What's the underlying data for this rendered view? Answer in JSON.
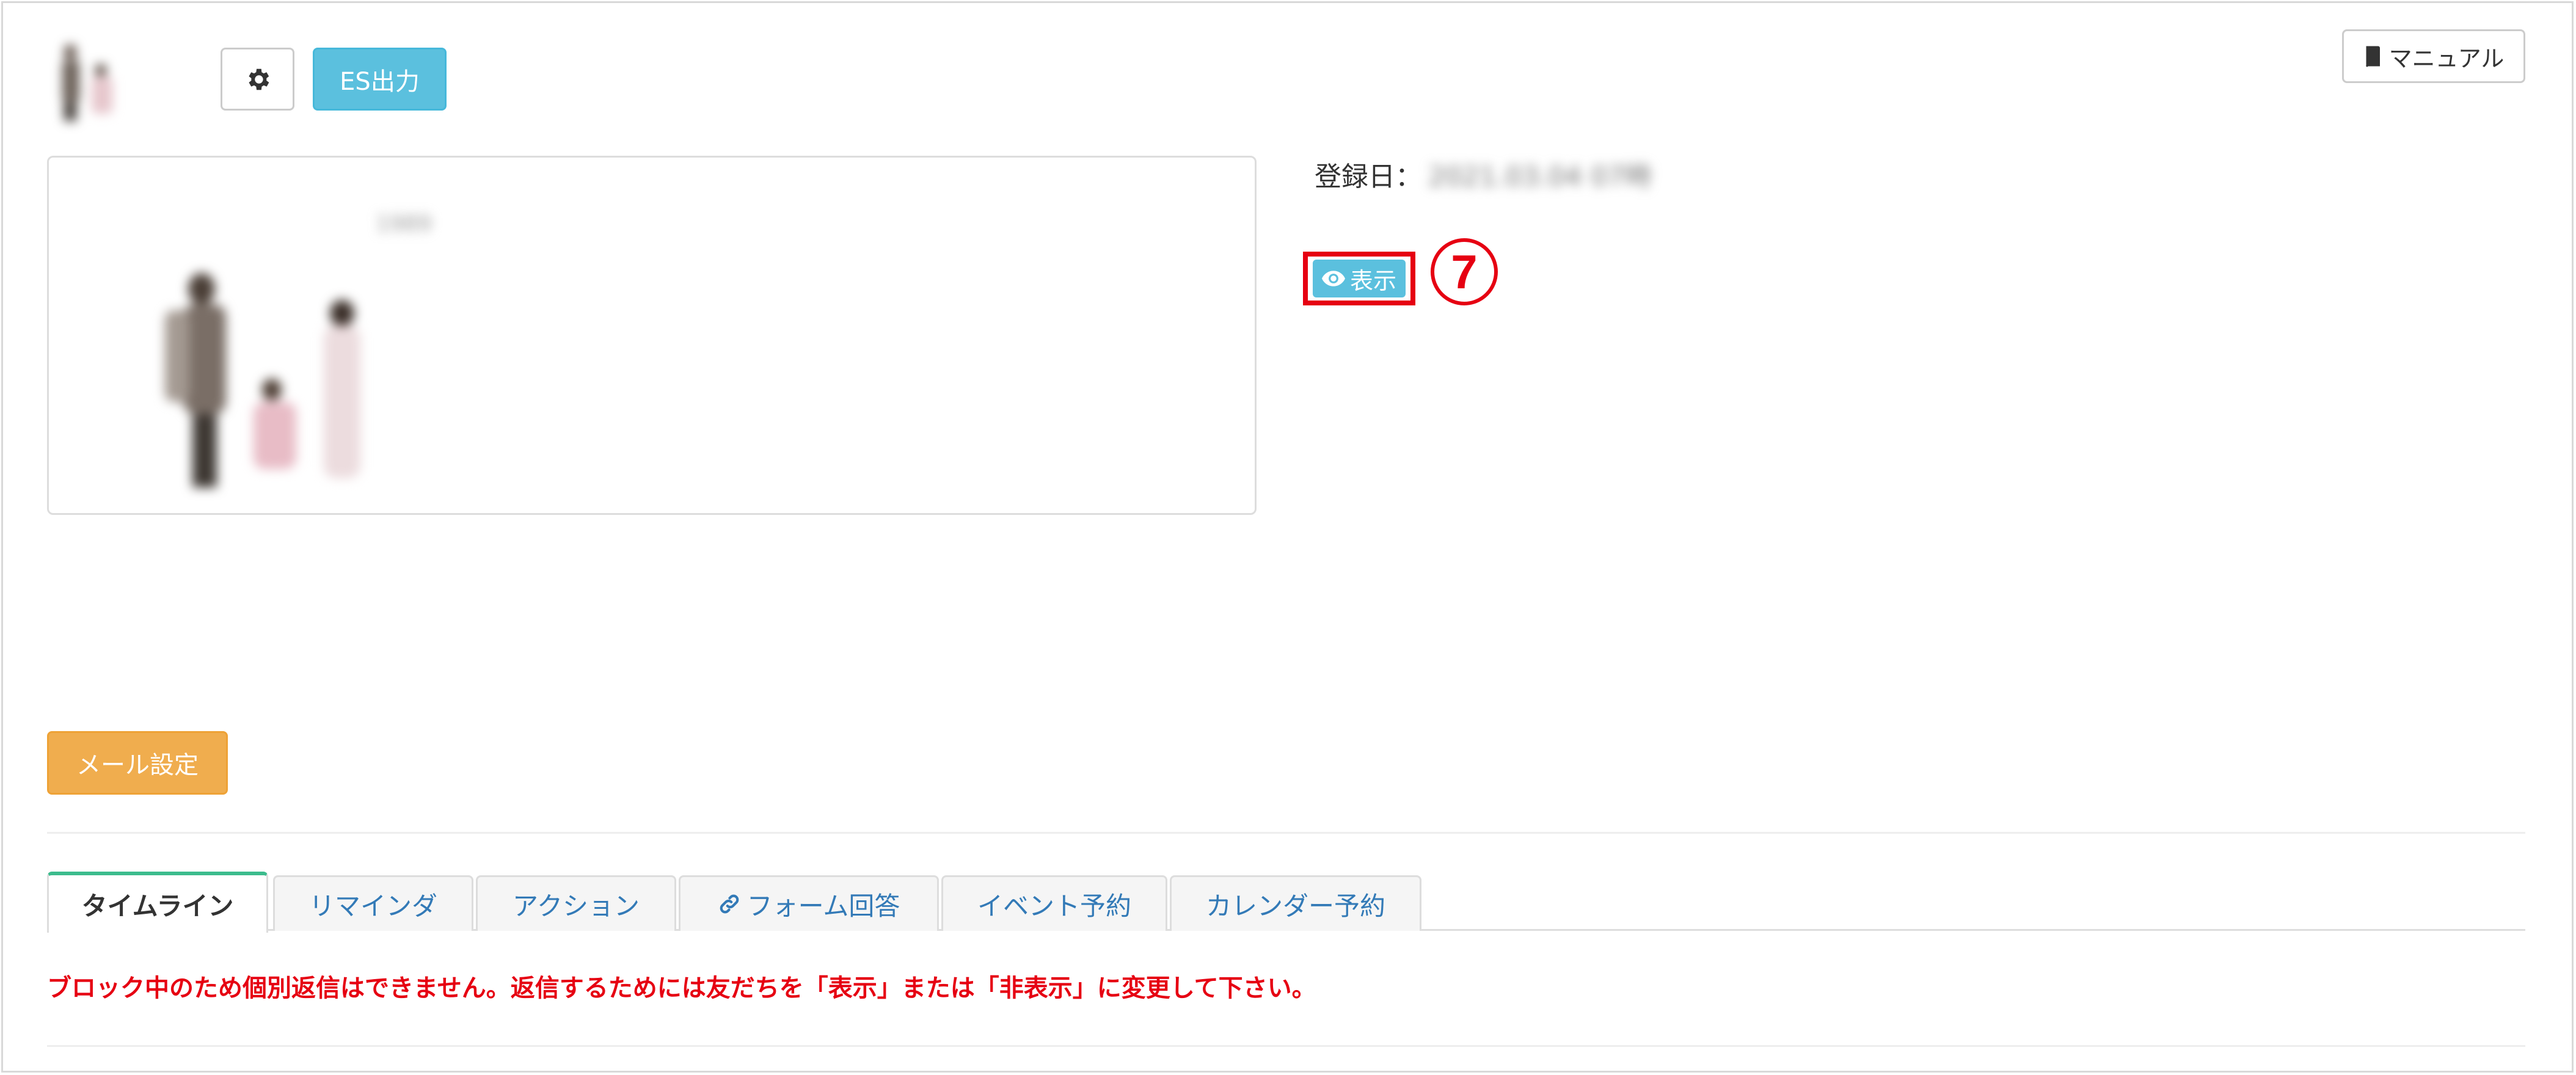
{
  "header": {
    "settings_icon": "gear-icon",
    "es_button_label": "ES出力",
    "manual_button_label": "マニュアル",
    "manual_icon": "book-icon"
  },
  "profile": {
    "name": "1989",
    "registered_label": "登録日：",
    "registered_value": "2021.03.04 07時",
    "status_badge": {
      "label": "表示",
      "icon": "eye-icon",
      "color": "#5bc0de"
    },
    "callout_number": "7"
  },
  "mail_settings_label": "メール設定",
  "tabs": [
    {
      "label": "タイムライン",
      "active": true
    },
    {
      "label": "リマインダ",
      "active": false
    },
    {
      "label": "アクション",
      "active": false
    },
    {
      "label": "フォーム回答",
      "active": false,
      "icon": "link-icon"
    },
    {
      "label": "イベント予約",
      "active": false
    },
    {
      "label": "カレンダー予約",
      "active": false
    }
  ],
  "warning_message": "ブロック中のため個別返信はできません。返信するためには友だちを「表示」または「非表示」に変更して下さい。",
  "colors": {
    "accent_info": "#5bc0de",
    "accent_warning": "#f0ad4e",
    "alert_red": "#e60012",
    "active_tab": "#3cbc8d"
  }
}
